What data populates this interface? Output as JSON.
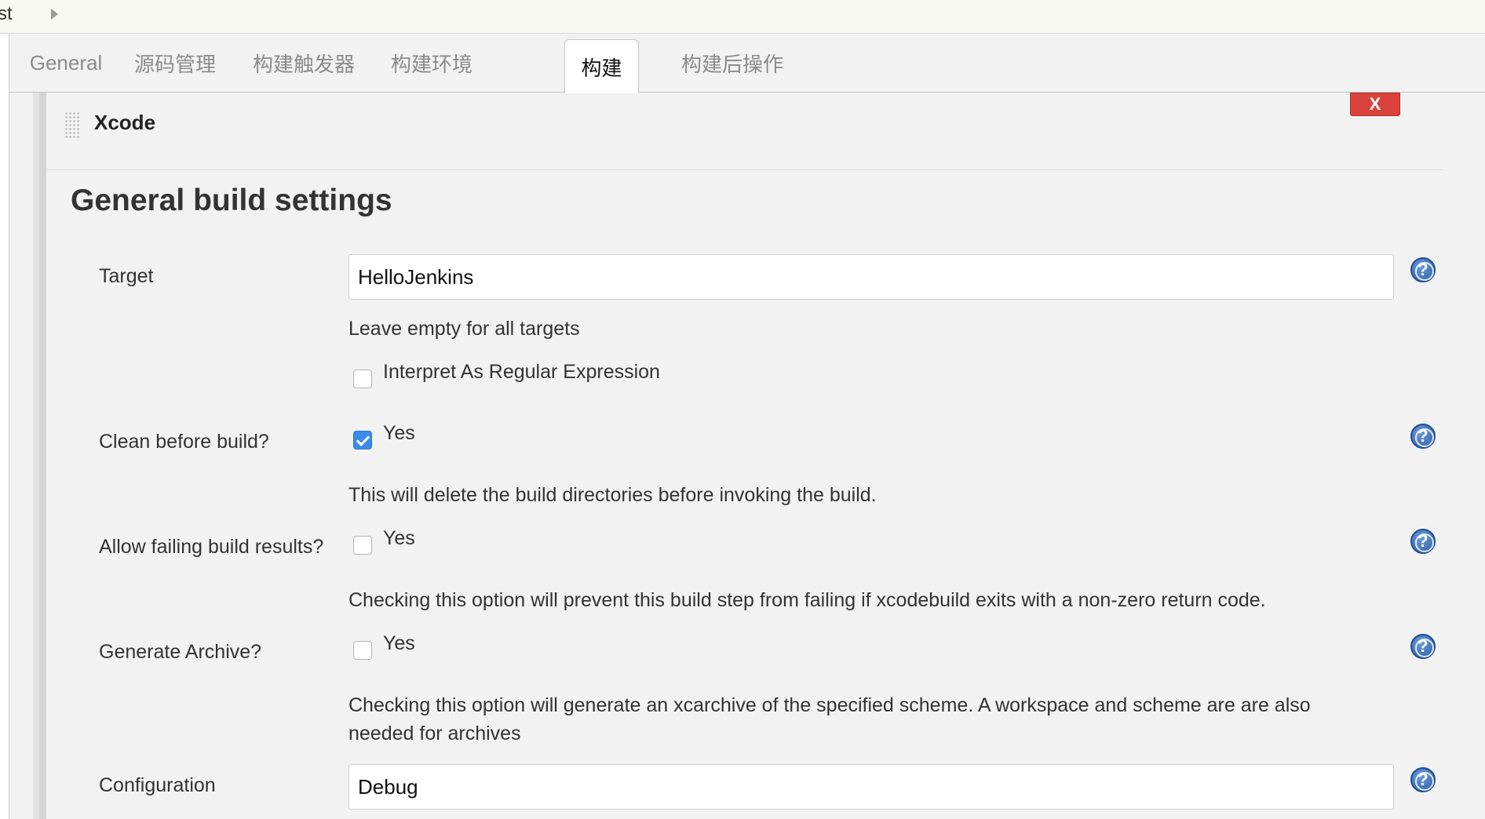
{
  "breadcrumb": {
    "text": "st"
  },
  "tabs": [
    {
      "label": "General"
    },
    {
      "label": "源码管理"
    },
    {
      "label": "构建触发器"
    },
    {
      "label": "构建环境"
    },
    {
      "label": "构建",
      "active": true
    },
    {
      "label": "构建后操作"
    }
  ],
  "builder": {
    "title": "Xcode",
    "delete_label": "X"
  },
  "section": {
    "heading": "General build settings"
  },
  "fields": {
    "target": {
      "label": "Target",
      "value": "HelloJenkins",
      "hint": "Leave empty for all targets",
      "regex_label": "Interpret As Regular Expression",
      "regex_checked": false
    },
    "clean": {
      "label": "Clean before build?",
      "option": "Yes",
      "checked": true,
      "hint": "This will delete the build directories before invoking the build."
    },
    "allow_failing": {
      "label": "Allow failing build results?",
      "option": "Yes",
      "checked": false,
      "hint": "Checking this option will prevent this build step from failing if xcodebuild exits with a non-zero return code."
    },
    "archive": {
      "label": "Generate Archive?",
      "option": "Yes",
      "checked": false,
      "hint": "Checking this option will generate an xcarchive of the specified scheme. A workspace and scheme are are also needed for archives"
    },
    "configuration": {
      "label": "Configuration",
      "value": "Debug"
    }
  },
  "help_icon_glyph": "?",
  "colors": {
    "delete_button": "#d9433b",
    "checkbox_checked": "#3b8be8",
    "help_icon": "#2a5ea8"
  }
}
